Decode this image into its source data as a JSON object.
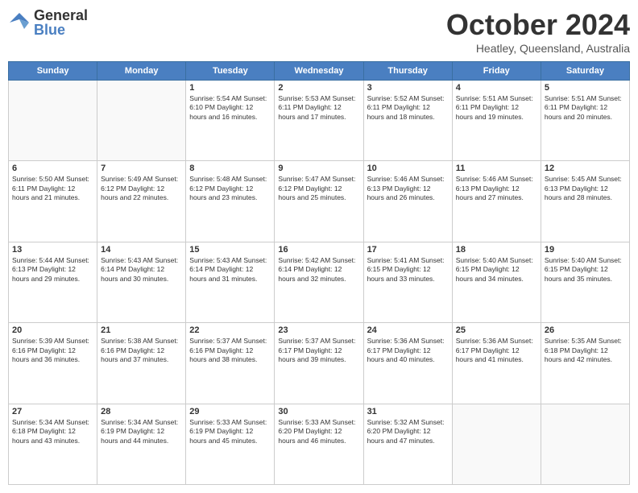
{
  "logo": {
    "general": "General",
    "blue": "Blue"
  },
  "title": "October 2024",
  "subtitle": "Heatley, Queensland, Australia",
  "days_of_week": [
    "Sunday",
    "Monday",
    "Tuesday",
    "Wednesday",
    "Thursday",
    "Friday",
    "Saturday"
  ],
  "weeks": [
    [
      {
        "day": "",
        "info": ""
      },
      {
        "day": "",
        "info": ""
      },
      {
        "day": "1",
        "info": "Sunrise: 5:54 AM\nSunset: 6:10 PM\nDaylight: 12 hours and 16 minutes."
      },
      {
        "day": "2",
        "info": "Sunrise: 5:53 AM\nSunset: 6:11 PM\nDaylight: 12 hours and 17 minutes."
      },
      {
        "day": "3",
        "info": "Sunrise: 5:52 AM\nSunset: 6:11 PM\nDaylight: 12 hours and 18 minutes."
      },
      {
        "day": "4",
        "info": "Sunrise: 5:51 AM\nSunset: 6:11 PM\nDaylight: 12 hours and 19 minutes."
      },
      {
        "day": "5",
        "info": "Sunrise: 5:51 AM\nSunset: 6:11 PM\nDaylight: 12 hours and 20 minutes."
      }
    ],
    [
      {
        "day": "6",
        "info": "Sunrise: 5:50 AM\nSunset: 6:11 PM\nDaylight: 12 hours and 21 minutes."
      },
      {
        "day": "7",
        "info": "Sunrise: 5:49 AM\nSunset: 6:12 PM\nDaylight: 12 hours and 22 minutes."
      },
      {
        "day": "8",
        "info": "Sunrise: 5:48 AM\nSunset: 6:12 PM\nDaylight: 12 hours and 23 minutes."
      },
      {
        "day": "9",
        "info": "Sunrise: 5:47 AM\nSunset: 6:12 PM\nDaylight: 12 hours and 25 minutes."
      },
      {
        "day": "10",
        "info": "Sunrise: 5:46 AM\nSunset: 6:13 PM\nDaylight: 12 hours and 26 minutes."
      },
      {
        "day": "11",
        "info": "Sunrise: 5:46 AM\nSunset: 6:13 PM\nDaylight: 12 hours and 27 minutes."
      },
      {
        "day": "12",
        "info": "Sunrise: 5:45 AM\nSunset: 6:13 PM\nDaylight: 12 hours and 28 minutes."
      }
    ],
    [
      {
        "day": "13",
        "info": "Sunrise: 5:44 AM\nSunset: 6:13 PM\nDaylight: 12 hours and 29 minutes."
      },
      {
        "day": "14",
        "info": "Sunrise: 5:43 AM\nSunset: 6:14 PM\nDaylight: 12 hours and 30 minutes."
      },
      {
        "day": "15",
        "info": "Sunrise: 5:43 AM\nSunset: 6:14 PM\nDaylight: 12 hours and 31 minutes."
      },
      {
        "day": "16",
        "info": "Sunrise: 5:42 AM\nSunset: 6:14 PM\nDaylight: 12 hours and 32 minutes."
      },
      {
        "day": "17",
        "info": "Sunrise: 5:41 AM\nSunset: 6:15 PM\nDaylight: 12 hours and 33 minutes."
      },
      {
        "day": "18",
        "info": "Sunrise: 5:40 AM\nSunset: 6:15 PM\nDaylight: 12 hours and 34 minutes."
      },
      {
        "day": "19",
        "info": "Sunrise: 5:40 AM\nSunset: 6:15 PM\nDaylight: 12 hours and 35 minutes."
      }
    ],
    [
      {
        "day": "20",
        "info": "Sunrise: 5:39 AM\nSunset: 6:16 PM\nDaylight: 12 hours and 36 minutes."
      },
      {
        "day": "21",
        "info": "Sunrise: 5:38 AM\nSunset: 6:16 PM\nDaylight: 12 hours and 37 minutes."
      },
      {
        "day": "22",
        "info": "Sunrise: 5:37 AM\nSunset: 6:16 PM\nDaylight: 12 hours and 38 minutes."
      },
      {
        "day": "23",
        "info": "Sunrise: 5:37 AM\nSunset: 6:17 PM\nDaylight: 12 hours and 39 minutes."
      },
      {
        "day": "24",
        "info": "Sunrise: 5:36 AM\nSunset: 6:17 PM\nDaylight: 12 hours and 40 minutes."
      },
      {
        "day": "25",
        "info": "Sunrise: 5:36 AM\nSunset: 6:17 PM\nDaylight: 12 hours and 41 minutes."
      },
      {
        "day": "26",
        "info": "Sunrise: 5:35 AM\nSunset: 6:18 PM\nDaylight: 12 hours and 42 minutes."
      }
    ],
    [
      {
        "day": "27",
        "info": "Sunrise: 5:34 AM\nSunset: 6:18 PM\nDaylight: 12 hours and 43 minutes."
      },
      {
        "day": "28",
        "info": "Sunrise: 5:34 AM\nSunset: 6:19 PM\nDaylight: 12 hours and 44 minutes."
      },
      {
        "day": "29",
        "info": "Sunrise: 5:33 AM\nSunset: 6:19 PM\nDaylight: 12 hours and 45 minutes."
      },
      {
        "day": "30",
        "info": "Sunrise: 5:33 AM\nSunset: 6:20 PM\nDaylight: 12 hours and 46 minutes."
      },
      {
        "day": "31",
        "info": "Sunrise: 5:32 AM\nSunset: 6:20 PM\nDaylight: 12 hours and 47 minutes."
      },
      {
        "day": "",
        "info": ""
      },
      {
        "day": "",
        "info": ""
      }
    ]
  ],
  "colors": {
    "header_bg": "#4a7fc1",
    "accent": "#4a7fc1"
  }
}
